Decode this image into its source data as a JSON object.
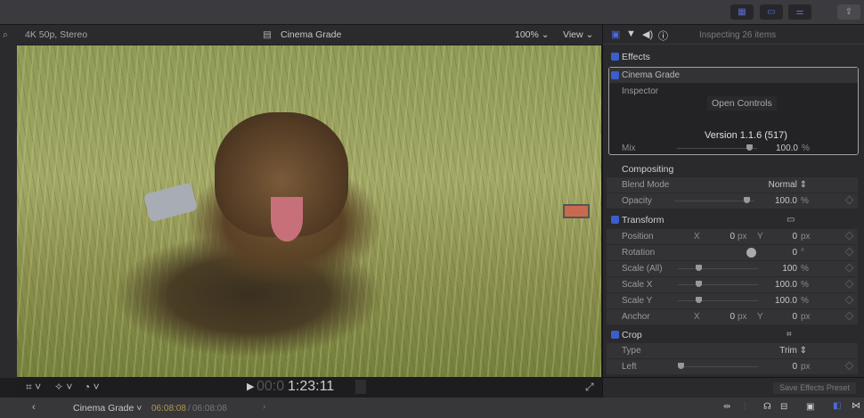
{
  "toolbar": {
    "buttons": [
      "browser-icon",
      "timeline-icon",
      "inspector-toggle-icon"
    ],
    "share": "share-icon"
  },
  "viewer": {
    "format": "4K 50p, Stereo",
    "clip_title": "Cinema Grade",
    "zoom": "100%",
    "view": "View",
    "timecode_dim": "00:0",
    "timecode": "1:23:11"
  },
  "inspector": {
    "status": "Inspecting 26 items",
    "effects": "Effects",
    "cinema_grade": "Cinema Grade",
    "inspector_label": "Inspector",
    "open_controls": "Open Controls",
    "version": "Version 1.1.6 (517)",
    "mix": {
      "label": "Mix",
      "value": "100.0",
      "unit": "%",
      "fraction": 0.9
    },
    "compositing": "Compositing",
    "blend_mode": {
      "label": "Blend Mode",
      "value": "Normal"
    },
    "opacity": {
      "label": "Opacity",
      "value": "100.0",
      "unit": "%",
      "fraction": 0.9
    },
    "transform": "Transform",
    "position": {
      "label": "Position",
      "x_label": "X",
      "x": "0",
      "y_label": "Y",
      "y": "0",
      "unit": "px"
    },
    "rotation": {
      "label": "Rotation",
      "value": "0",
      "unit": "°"
    },
    "scale_all": {
      "label": "Scale (All)",
      "value": "100",
      "unit": "%"
    },
    "scale_x": {
      "label": "Scale X",
      "value": "100.0",
      "unit": "%"
    },
    "scale_y": {
      "label": "Scale Y",
      "value": "100.0",
      "unit": "%"
    },
    "anchor": {
      "label": "Anchor",
      "x_label": "X",
      "x": "0",
      "y_label": "Y",
      "y": "0",
      "unit": "px"
    },
    "crop": "Crop",
    "type": {
      "label": "Type",
      "value": "Trim"
    },
    "left": {
      "label": "Left",
      "value": "0",
      "unit": "px"
    },
    "save_preset": "Save Effects Preset"
  },
  "bottom": {
    "project": "Cinema Grade",
    "time_current": "06:08:08",
    "time_sep": "/",
    "time_total": "06:08:08"
  }
}
